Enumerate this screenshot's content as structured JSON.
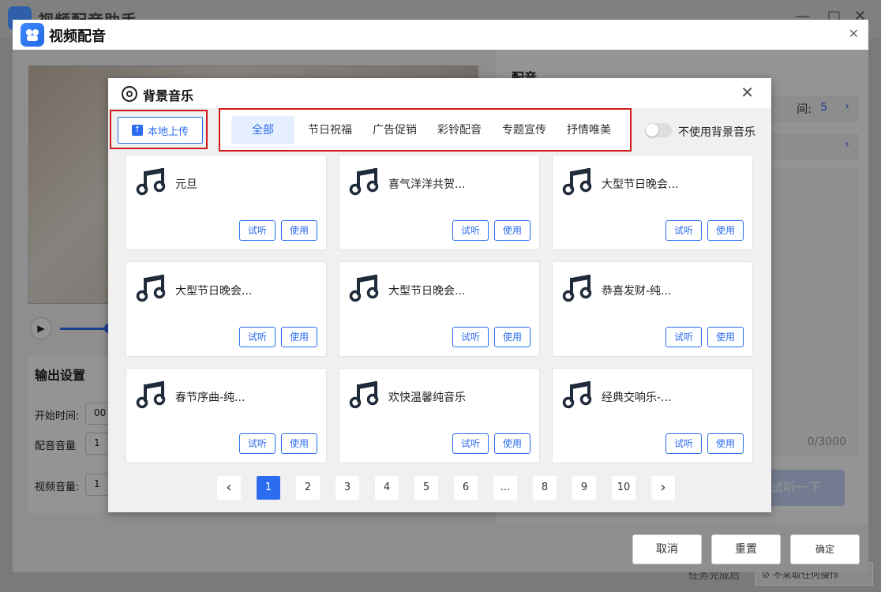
{
  "background_app": {
    "title": "视频配音助手",
    "bottom_label": "任务完成后",
    "bottom_select": "不采取任何操作"
  },
  "dialog": {
    "title": "视频配音",
    "output_settings": {
      "title": "输出设置",
      "rows": [
        {
          "label": "开始时间:",
          "value": "00"
        },
        {
          "label": "配音音量",
          "value": "1"
        },
        {
          "label": "视频音量:",
          "value": "1"
        }
      ]
    },
    "right_panel": {
      "title": "配音",
      "row1_label": "间:",
      "row1_value": "5",
      "char_count": "0/3000",
      "listen_button": "试听一下"
    },
    "footer": {
      "cancel": "取消",
      "reset": "重置",
      "confirm": "确定"
    }
  },
  "modal": {
    "title": "背景音乐",
    "upload_label": "本地上传",
    "tabs": [
      "全部",
      "节日祝福",
      "广告促销",
      "彩铃配音",
      "专题宣传",
      "抒情唯美"
    ],
    "no_bg_music_label": "不使用背景音乐",
    "no_bg_music_enabled": false,
    "listen_label": "试听",
    "use_label": "使用",
    "tracks": [
      "元旦",
      "喜气洋洋共贺...",
      "大型节日晚会...",
      "大型节日晚会...",
      "大型节日晚会...",
      "恭喜发财-纯...",
      "春节序曲-纯...",
      "欢快温馨纯音乐",
      "经典交响乐-..."
    ],
    "pagination": {
      "pages": [
        "1",
        "2",
        "3",
        "4",
        "5",
        "6",
        "...",
        "8",
        "9",
        "10"
      ],
      "current": "1"
    }
  },
  "colors": {
    "accent": "#2b6cf0",
    "highlight_border": "#d01a1a"
  }
}
